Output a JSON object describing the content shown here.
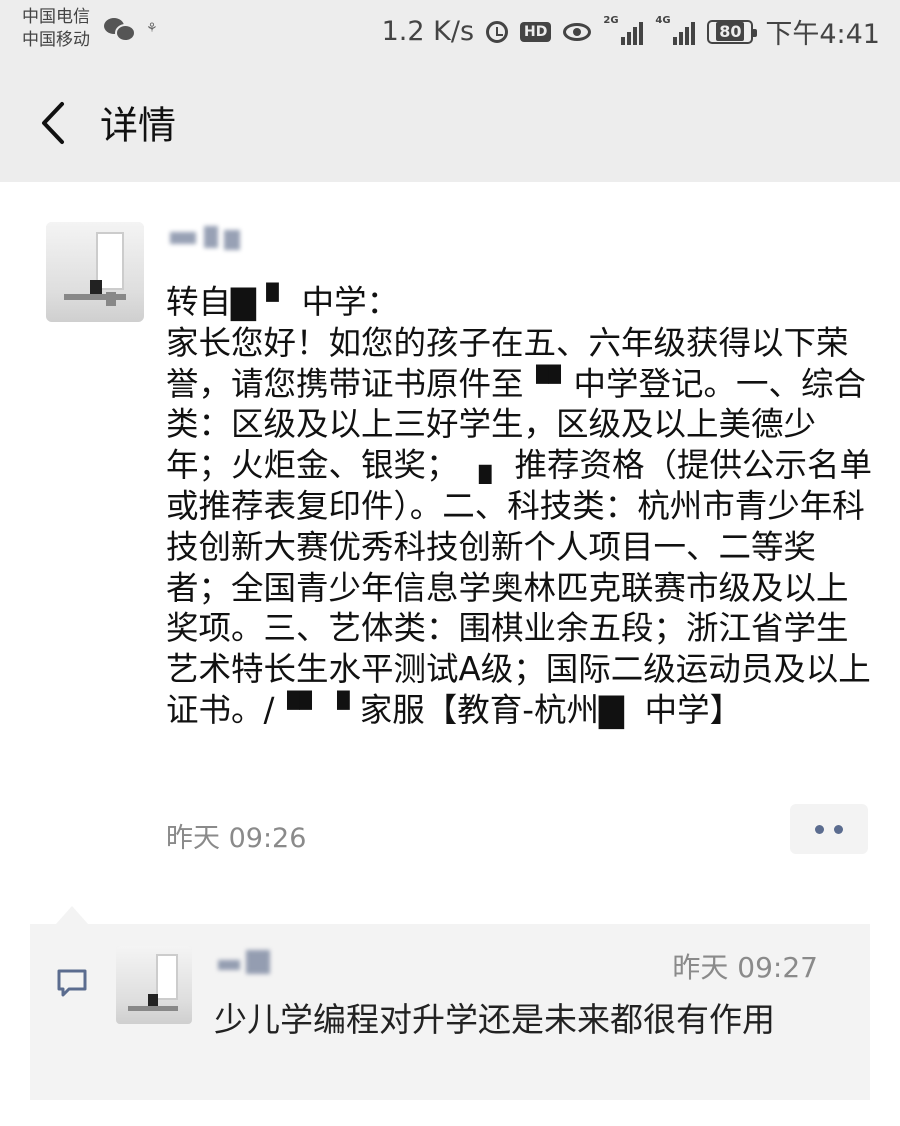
{
  "status_bar": {
    "carrier_1": "中国电信",
    "carrier_2": "中国移动",
    "speed": "1.2 K/s",
    "hd_label": "HD",
    "signal_1_label": "2G",
    "signal_2_label": "4G",
    "battery_level": "80",
    "clock": "下午4:41",
    "icons": [
      "wechat-icon",
      "notification-icon",
      "alarm-icon",
      "hd-icon",
      "eye-icon",
      "signal-2g-icon",
      "signal-4g-icon",
      "battery-icon"
    ]
  },
  "nav": {
    "title": "详情",
    "back_icon": "chevron-left-icon"
  },
  "post": {
    "text": "转自▇ ▘ 中学：\n家长您好！如您的孩子在五、六年级获得以下荣誉，请您携带证书原件至▝▘中学登记。一、综合类：区级及以上三好学生，区级及以上美德少年；火炬金、银奖；  ▖ 推荐资格（提供公示名单或推荐表复印件）。二、科技类：杭州市青少年科技创新大赛优秀科技创新个人项目一、二等奖者；全国青少年信息学奥林匹克联赛市级及以上奖项。三、艺体类：围棋业余五段；浙江省学生艺术特长生水平测试A级；国际二级运动员及以上证书。/▝▘▝ 家服【教育-杭州▇  中学】",
    "time": "昨天 09:26",
    "more_icon": "more-dots-icon"
  },
  "comment": {
    "icon": "comment-icon",
    "time": "昨天 09:27",
    "text": "少儿学编程对升学还是未来都很有作用"
  },
  "colors": {
    "bar_bg": "#ededed",
    "comment_bg": "#f3f3f3",
    "link_blue": "#5b6c8f",
    "muted_text": "#8a8a8a"
  }
}
